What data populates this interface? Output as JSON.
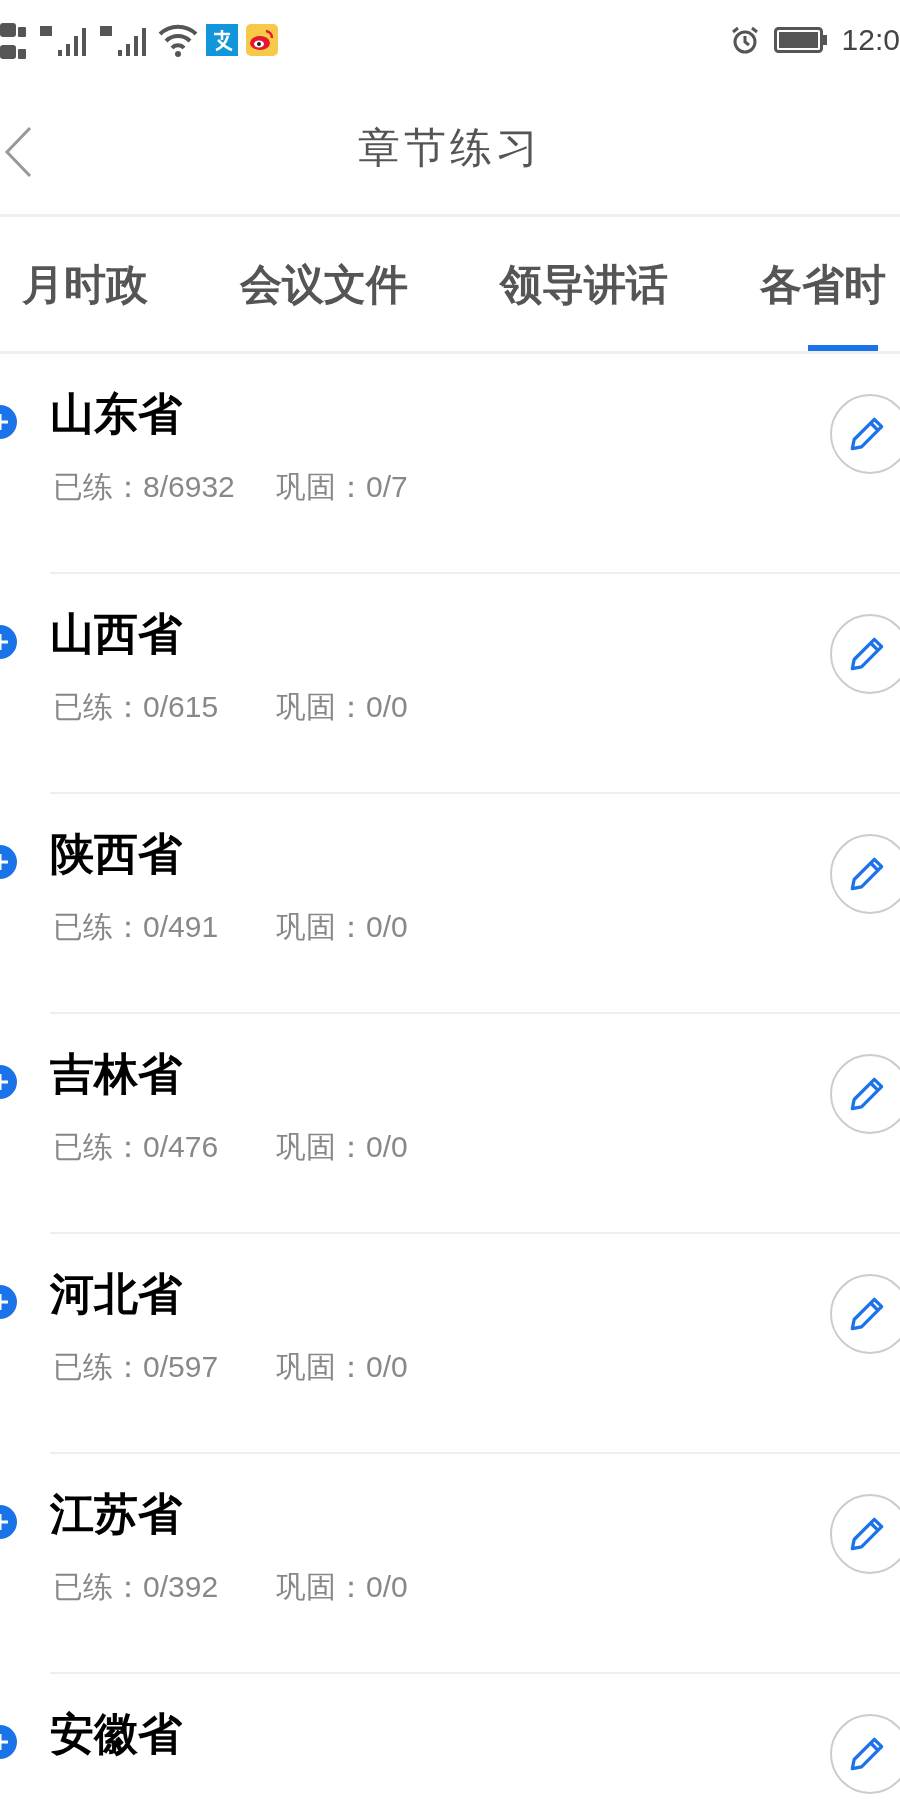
{
  "status_bar": {
    "time": "12:0"
  },
  "header": {
    "title": "章节练习"
  },
  "tabs": [
    {
      "label": "月时政",
      "selected": false
    },
    {
      "label": "会议文件",
      "selected": false
    },
    {
      "label": "领导讲话",
      "selected": false
    },
    {
      "label": "各省时",
      "selected": true
    }
  ],
  "items": [
    {
      "title": "山东省",
      "practiced": "已练：8/6932",
      "review": "巩固：0/7"
    },
    {
      "title": "山西省",
      "practiced": "已练：0/615",
      "review": "巩固：0/0"
    },
    {
      "title": "陕西省",
      "practiced": "已练：0/491",
      "review": "巩固：0/0"
    },
    {
      "title": "吉林省",
      "practiced": "已练：0/476",
      "review": "巩固：0/0"
    },
    {
      "title": "河北省",
      "practiced": "已练：0/597",
      "review": "巩固：0/0"
    },
    {
      "title": "江苏省",
      "practiced": "已练：0/392",
      "review": "巩固：0/0"
    },
    {
      "title": "安徽省"
    }
  ]
}
